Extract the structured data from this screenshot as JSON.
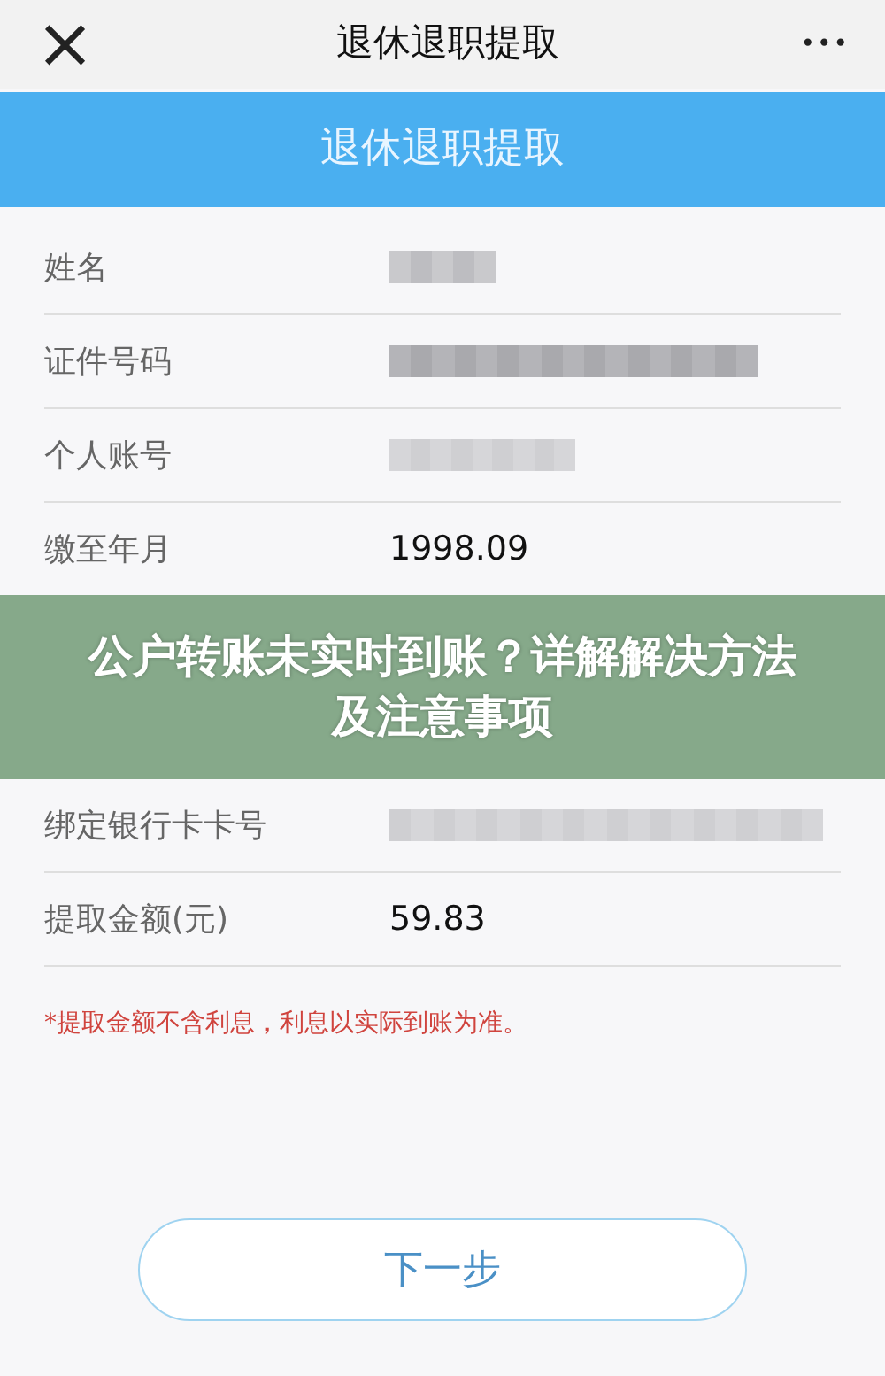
{
  "nav_bar": {
    "close": "×",
    "title": "退休退职提取",
    "more": "•••"
  },
  "header": {
    "title": "退休退职提取"
  },
  "rows": [
    {
      "label": "姓名",
      "kind": "masked"
    },
    {
      "label": "证件号码",
      "kind": "masked"
    },
    {
      "label": "个人账号",
      "kind": "masked"
    },
    {
      "label": "缴至年月",
      "kind": "text",
      "value": "1998.09"
    },
    {
      "kind": "banner",
      "title": "公户转账未实时到账？详解解决方法及注意事项"
    },
    {
      "label": "绑定银行卡卡号",
      "kind": "masked"
    },
    {
      "label": "提取金额(元)",
      "kind": "text",
      "value": "59.83"
    }
  ],
  "note": "*提取金额不含利息，利息以实际到账为准。",
  "next_button": "下一步"
}
